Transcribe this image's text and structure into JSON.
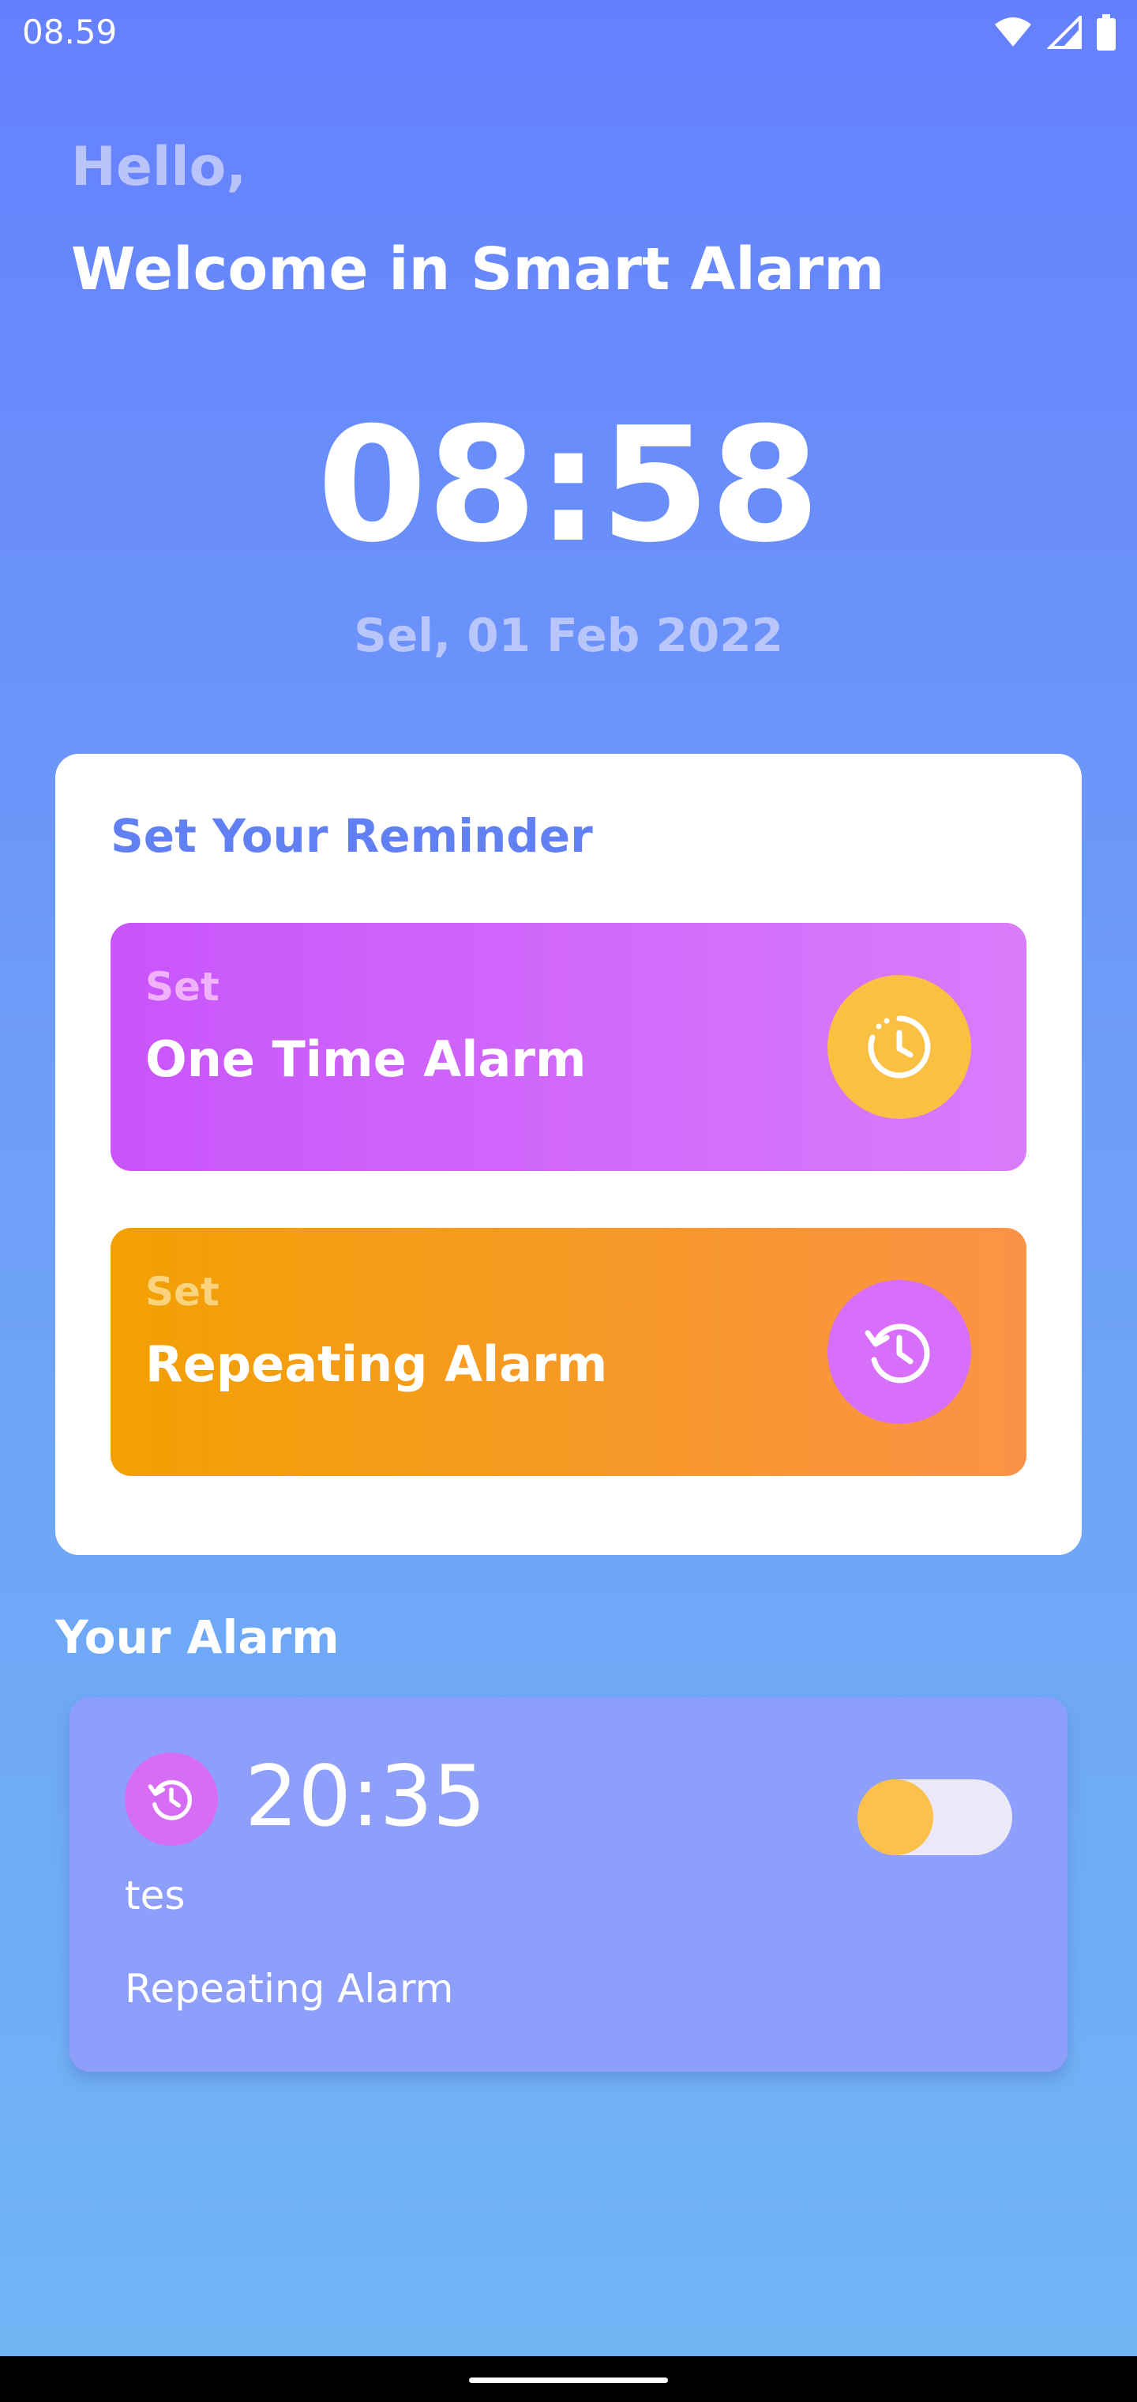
{
  "status_bar": {
    "time": "08.59",
    "icons": [
      "wifi-icon",
      "cell-signal-icon",
      "battery-icon"
    ]
  },
  "header": {
    "greeting": "Hello,",
    "welcome": "Welcome in Smart Alarm"
  },
  "clock": {
    "time": "08:58",
    "date": "Sel, 01 Feb 2022"
  },
  "reminder": {
    "title": "Set Your Reminder",
    "options": [
      {
        "small_label": "Set",
        "label": "One Time Alarm",
        "icon": "alarm-clock-icon",
        "accent": "#fbbf42"
      },
      {
        "small_label": "Set",
        "label": "Repeating Alarm",
        "icon": "history-clock-icon",
        "accent": "#d86ffb"
      }
    ]
  },
  "alarms": {
    "title": "Your Alarm",
    "items": [
      {
        "time": "20:35",
        "label": "tes",
        "type": "Repeating Alarm",
        "icon": "history-clock-icon",
        "enabled": true
      }
    ]
  },
  "colors": {
    "background_top": "#6580fe",
    "background_bottom": "#71b6f5",
    "accent_title": "#6180f3",
    "one_time_gradient": [
      "#c955fb",
      "#d97cfb"
    ],
    "repeating_gradient": [
      "#f2a002",
      "#fb9347"
    ],
    "alarm_card": "#8d9efb",
    "toggle_knob": "#fcc14d"
  }
}
